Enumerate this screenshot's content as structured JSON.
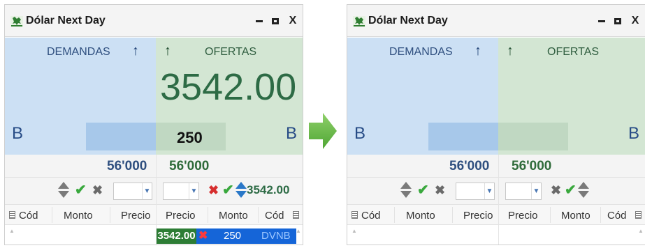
{
  "window_title": "Dólar Next Day",
  "window_controls": {
    "minimize": "‒",
    "maximize": "□",
    "close": "X"
  },
  "labels": {
    "demands": "DEMANDAS",
    "offers": "OFERTAS",
    "b_left": "B",
    "b_right": "B"
  },
  "before": {
    "best_offer_price": "3542.00",
    "best_offer_qty": "250",
    "total_demand": "56'000",
    "total_offer": "56'000",
    "order_price": "3542.00",
    "orders": [
      {
        "precio": "3542.00",
        "monto": "250",
        "cod": "DVNB"
      }
    ]
  },
  "after": {
    "total_demand": "56'000",
    "total_offer": "56'000"
  },
  "columns_demand": [
    "Cód",
    "Monto",
    "Precio"
  ],
  "columns_offer": [
    "Precio",
    "Monto",
    "Cód"
  ],
  "colors": {
    "demand_bg": "#cce0f4",
    "offer_bg": "#d3e6d3",
    "price_green": "#2d6b45",
    "selected_row": "#1565d8",
    "flow_arrow": "#6cbf4a"
  },
  "icons": [
    "app-logo-icon",
    "arrow-up-icon",
    "updown-icon",
    "check-icon",
    "cross-icon",
    "dropdown-icon",
    "column-menu-icon",
    "flow-arrow-icon"
  ]
}
